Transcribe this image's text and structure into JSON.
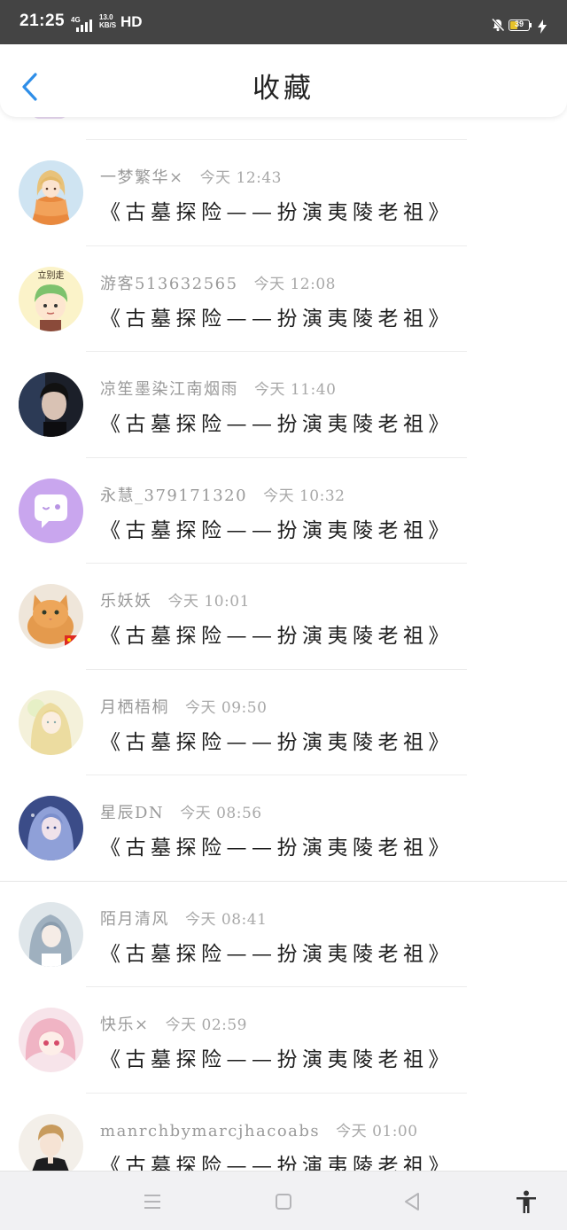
{
  "status_bar": {
    "time": "21:25",
    "network": "4G",
    "speed_value": "13.0",
    "speed_unit": "KB/S",
    "hd": "HD",
    "battery_level": "39"
  },
  "header": {
    "title": "收藏",
    "back_icon": "chevron-left-icon"
  },
  "items": [
    {
      "name": "一梦繁华×",
      "time": "今天 12:43",
      "book": "《古墓探险——扮演夷陵老祖》",
      "avatar": "girl-orange-dress"
    },
    {
      "name": "游客513632565",
      "time": "今天 12:08",
      "book": "《古墓探险——扮演夷陵老祖》",
      "avatar": "cartoon-boy"
    },
    {
      "name": "凉笙墨染江南烟雨",
      "time": "今天 11:40",
      "book": "《古墓探险——扮演夷陵老祖》",
      "avatar": "dark-portrait"
    },
    {
      "name": "永慧_379171320",
      "time": "今天 10:32",
      "book": "《古墓探险——扮演夷陵老祖》",
      "avatar": "purple-chat-bubble"
    },
    {
      "name": "乐妖妖",
      "time": "今天 10:01",
      "book": "《古墓探险——扮演夷陵老祖》",
      "avatar": "orange-cat"
    },
    {
      "name": "月栖梧桐",
      "time": "今天 09:50",
      "book": "《古墓探险——扮演夷陵老祖》",
      "avatar": "blonde-girl"
    },
    {
      "name": "星辰DN",
      "time": "今天 08:56",
      "book": "《古墓探险——扮演夷陵老祖》",
      "avatar": "blue-hair-girl"
    },
    {
      "name": "陌月清风",
      "time": "今天 08:41",
      "book": "《古墓探险——扮演夷陵老祖》",
      "avatar": "silver-hair-boy"
    },
    {
      "name": "快乐×",
      "time": "今天 02:59",
      "book": "《古墓探险——扮演夷陵老祖》",
      "avatar": "pink-hair-girl"
    },
    {
      "name": "manrchbymarcjhacoabs",
      "time": "今天 01:00",
      "book": "《古墓探险——扮演夷陵老祖》",
      "avatar": "anime-boy-dark-coat"
    }
  ],
  "nav_bar": {
    "menu_icon": "menu-icon",
    "home_icon": "home-square-icon",
    "back_icon": "back-triangle-icon",
    "accessibility_icon": "accessibility-icon"
  }
}
